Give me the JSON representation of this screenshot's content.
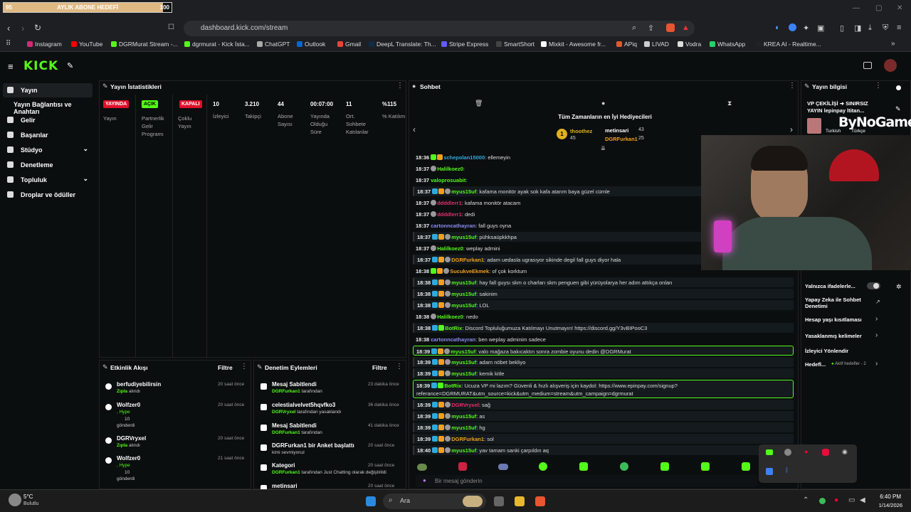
{
  "goal": {
    "left": "95",
    "title": "AYLIK ABONE HEDEFİ",
    "right": "100",
    "progress": 0.95
  },
  "browser": {
    "url": "dashboard.kick.com/stream"
  },
  "bookmarks": [
    "Instagram",
    "YouTube",
    "DGRMurat Stream -...",
    "dgrmurat - Kick İsta...",
    "ChatGPT",
    "Outlook",
    "Gmail",
    "DeepL Translate: Th...",
    "Stripe Express",
    "SmartShort",
    "Mixkit - Awesome fr...",
    "APiq",
    "LIVAD",
    "Vodra",
    "WhatsApp",
    "KREA AI - Realtime..."
  ],
  "sidebar": {
    "items": [
      {
        "label": "Yayın"
      },
      {
        "label": "Yayın Bağlantısı ve Anahtarı"
      },
      {
        "label": "Gelir"
      },
      {
        "label": "Başarılar"
      },
      {
        "label": "Stüdyo"
      },
      {
        "label": "Denetleme"
      },
      {
        "label": "Topluluk"
      },
      {
        "label": "Droplar ve ödüller"
      }
    ]
  },
  "stats": {
    "title": "Yayın İstatistikleri",
    "badges": [
      "YAYINDA",
      "AÇIK",
      "KAPALI"
    ],
    "labels": [
      "Yayın",
      "Partnerlik Gelir Programı",
      "Çoklu Yayın"
    ],
    "values": [
      {
        "v": "10",
        "l": "İzleyici"
      },
      {
        "v": "3.210",
        "l": "Takipçi"
      },
      {
        "v": "44",
        "l": "Abone Sayısı"
      },
      {
        "v": "00:07:00",
        "l": "Yayında Olduğu Süre"
      },
      {
        "v": "11",
        "l": "Ort. Sohbete Katılanlar"
      },
      {
        "v": "%115",
        "l": "% Katılım"
      }
    ]
  },
  "events": {
    "title": "Etkinlik Akışı",
    "filter": "Filtre",
    "items": [
      {
        "name": "berfudiyebilirsin",
        "sub": "Zıpla",
        "suffix": "alındı",
        "time": "20 saat önce"
      },
      {
        "name": "Wolfzer0",
        "sub": ", Hype",
        "amount": "10",
        "suffix": "gönderdi",
        "time": "20 saat önce"
      },
      {
        "name": "DGRVryxel",
        "sub": "Zıpla",
        "suffix": "alındı",
        "time": "20 saat önce"
      },
      {
        "name": "Wolfzer0",
        "sub": ", Hype",
        "amount": "10",
        "suffix": "gönderdi",
        "time": "21 saat önce"
      }
    ]
  },
  "moderation": {
    "title": "Denetim Eylemleri",
    "filter": "Filtre",
    "items": [
      {
        "name": "Mesaj Sabitlendi",
        "sub": "DGRFurkan1",
        "suffix": "tarafından",
        "time": "23 dakika önce"
      },
      {
        "name": "celestialvelvet5hqvfko3",
        "sub": "DGRVryxel",
        "suffix": "tarafından yasaklandı",
        "time": "36 dakika önce"
      },
      {
        "name": "Mesaj Sabitlendi",
        "sub": "DGRFurkan1",
        "suffix": "tarafından",
        "time": "41 dakika önce"
      },
      {
        "name": "DGRFurkan1 bir Anket başlattı",
        "sub": "",
        "suffix": "kimi sevmiyoruz",
        "time": "20 saat önce"
      },
      {
        "name": "Kategori",
        "sub": "DGRFurkan1",
        "suffix": "tarafından Just Chatting olarak değiştirildi",
        "time": "20 saat önce"
      },
      {
        "name": "metinsari",
        "sub": "",
        "suffix": "",
        "time": "20 saat önce"
      }
    ]
  },
  "chat": {
    "title": "Sohbet",
    "gifters_title": "Tüm Zamanların en İyi Hediyecileri",
    "gifters": [
      {
        "name": "thoothez",
        "amount": "45"
      },
      {
        "name": "metinsari",
        "amount": "43"
      },
      {
        "name": "DGRFurkan1",
        "amount": "25"
      }
    ],
    "placeholder": "Bir mesaj gönderin",
    "messages": [
      {
        "t": "18:36",
        "u": "schepolan15000",
        "c": "#2fa9dc",
        "m": "ellemeyin",
        "b": [
          "g",
          "y"
        ],
        "hl": false
      },
      {
        "t": "18:37",
        "u": "Halilkoez0",
        "c": "#53fc18",
        "m": "",
        "b": [
          "c"
        ],
        "hl": false
      },
      {
        "t": "18:37",
        "u": "valoprosuabit",
        "c": "#53fc18",
        "m": "",
        "b": [],
        "hl": false
      },
      {
        "t": "18:37",
        "u": "myus15uf",
        "c": "#53fc18",
        "m": "kafama monitör ayak sok kafa atarım baya güzel cümle",
        "b": [
          "b",
          "y",
          "c"
        ],
        "hl": true
      },
      {
        "t": "18:37",
        "u": "ddddlerr1",
        "c": "#e0306a",
        "m": "kafama monitör atacam",
        "b": [
          "c"
        ],
        "hl": false
      },
      {
        "t": "18:37",
        "u": "ddddlerr1",
        "c": "#e0306a",
        "m": "dedi",
        "b": [
          "c"
        ],
        "hl": false
      },
      {
        "t": "18:37",
        "u": "cartonncathayran",
        "c": "#8a8af0",
        "m": "fall guys oyna",
        "b": [],
        "hl": false
      },
      {
        "t": "18:37",
        "u": "myus15uf",
        "c": "#53fc18",
        "m": "pühksaüpkkhpa",
        "b": [
          "b",
          "y",
          "c"
        ],
        "hl": true
      },
      {
        "t": "18:37",
        "u": "Halilkoez0",
        "c": "#53fc18",
        "m": "weplay admini",
        "b": [
          "c"
        ],
        "hl": false
      },
      {
        "t": "18:37",
        "u": "DGRFurkan1",
        "c": "#f0a020",
        "m": "adam uedasla ugrasıyor sikinde degil fall guys diyor hala",
        "b": [
          "b",
          "y",
          "c"
        ],
        "hl": true
      },
      {
        "t": "18:38",
        "u": "SucukveEkmek",
        "c": "#f0a020",
        "m": "of çok korktum",
        "b": [
          "g",
          "y",
          "c"
        ],
        "hl": false
      },
      {
        "t": "18:38",
        "u": "myus15uf",
        "c": "#53fc18",
        "m": "hay fall guysı skm o charları skm penguen gibi yürüyolarya her adım attıkça onları",
        "b": [
          "b",
          "y",
          "c"
        ],
        "hl": true
      },
      {
        "t": "18:38",
        "u": "myus15uf",
        "c": "#53fc18",
        "m": "sakinim",
        "b": [
          "b",
          "y",
          "c"
        ],
        "hl": true
      },
      {
        "t": "18:38",
        "u": "myus15uf",
        "c": "#53fc18",
        "m": "LOL",
        "b": [
          "b",
          "y",
          "c"
        ],
        "hl": true
      },
      {
        "t": "18:38",
        "u": "Halilkoez0",
        "c": "#53fc18",
        "m": "nedo",
        "b": [
          "c"
        ],
        "hl": false
      },
      {
        "t": "18:38",
        "u": "BotRix",
        "c": "#53fc18",
        "m": "Discord Topluluğumuza Katılmayı Unutmayın! https://discord.gg/Y3vBIPooC3",
        "b": [
          "b",
          "g"
        ],
        "hl": true
      },
      {
        "t": "18:38",
        "u": "cartonncathayran",
        "c": "#8a8af0",
        "m": "ben weplay adminim sadece",
        "b": [],
        "hl": false
      },
      {
        "t": "18:39",
        "u": "myus15uf",
        "c": "#53fc18",
        "m": "valo mağaza bakıcaktın sonra zombie oyunu dedin @DGRMurat",
        "b": [
          "b",
          "y",
          "c"
        ],
        "hl": true,
        "mention": true
      },
      {
        "t": "18:39",
        "u": "myus15uf",
        "c": "#53fc18",
        "m": "adam nöbet bekliyo",
        "b": [
          "b",
          "y",
          "c"
        ],
        "hl": true
      },
      {
        "t": "18:39",
        "u": "myus15uf",
        "c": "#53fc18",
        "m": "kemik kitle",
        "b": [
          "b",
          "y",
          "c"
        ],
        "hl": true
      },
      {
        "t": "18:39",
        "u": "BotRix",
        "c": "#53fc18",
        "m": "Ucuza VP mi lazım? Güvenli & hızlı alışveriş için kaydol: https://www.epinpay.com/signup?referance=DGRMURAT&utm_source=kick&utm_medium=stream&utm_campaign=dgrmurat",
        "b": [
          "b",
          "g"
        ],
        "hl": true,
        "mention": true,
        "tall": true
      },
      {
        "t": "18:39",
        "u": "DGRVryxel",
        "c": "#e0306a",
        "m": "sağ",
        "b": [
          "b",
          "y",
          "c"
        ],
        "hl": true
      },
      {
        "t": "18:39",
        "u": "myus15uf",
        "c": "#53fc18",
        "m": "as",
        "b": [
          "b",
          "y",
          "c"
        ],
        "hl": true
      },
      {
        "t": "18:39",
        "u": "myus15uf",
        "c": "#53fc18",
        "m": "hg",
        "b": [
          "b",
          "y",
          "c"
        ],
        "hl": true
      },
      {
        "t": "18:39",
        "u": "DGRFurkan1",
        "c": "#f0a020",
        "m": "sol",
        "b": [
          "b",
          "y",
          "c"
        ],
        "hl": true
      },
      {
        "t": "18:40",
        "u": "myus15uf",
        "c": "#53fc18",
        "m": "yav tamam sanki çarpıldın aq",
        "b": [
          "b",
          "y",
          "c"
        ],
        "hl": true
      }
    ]
  },
  "info": {
    "title": "Yayın bilgisi",
    "stream_title": "VP ÇEKİLİŞİ ➜ SINIRSIZ YAYIN lepinpay ltitan...",
    "tags": [
      "Turkish",
      "Türkçe"
    ],
    "overlay": "ByNoGame",
    "items": [
      "Yalnızca ifadelerle...",
      "Yapay Zeka ile Sohbet Denetimi",
      "Hesap yaşı kısıtlaması",
      "Yasaklanmış kelimeler",
      "İzleyici Yönlendir",
      "Hedefl...",
      "Aktif hedefler - 2"
    ]
  },
  "taskbar": {
    "weather": "5°C",
    "weather_sub": "Bulutlu",
    "search": "Ara",
    "time": "6:40 PM",
    "date": "1/14/2026"
  }
}
